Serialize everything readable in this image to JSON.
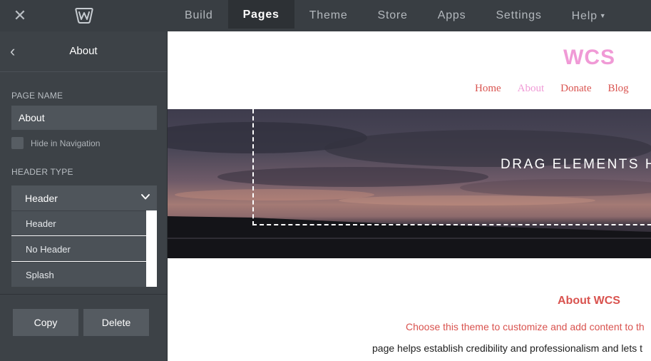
{
  "topbar": {
    "tabs": [
      {
        "label": "Build"
      },
      {
        "label": "Pages"
      },
      {
        "label": "Theme"
      },
      {
        "label": "Store"
      },
      {
        "label": "Apps"
      },
      {
        "label": "Settings"
      },
      {
        "label": "Help"
      }
    ],
    "active_tab": "Pages"
  },
  "sidebar": {
    "title": "About",
    "page_name_label": "PAGE NAME",
    "page_name_value": "About",
    "hide_nav_label": "Hide in Navigation",
    "header_type_label": "HEADER TYPE",
    "header_type_selected": "Header",
    "header_options": [
      "Header",
      "No Header",
      "Splash"
    ],
    "copy_label": "Copy",
    "delete_label": "Delete"
  },
  "preview": {
    "site_title": "WCS",
    "nav_links": [
      "Home",
      "About",
      "Donate",
      "Blog"
    ],
    "active_link": "About",
    "banner_text": "DRAG ELEMENTS HE",
    "about_heading": "About WCS",
    "paragraph_line1": "Choose this theme to customize and add content to th",
    "paragraph_line2": "page helps establish credibility and professionalism and lets t"
  },
  "colors": {
    "accent": "#d9534f",
    "brand_pink": "#f09ad6",
    "topbar_bg": "#393e43",
    "sidebar_bg": "#3d4247"
  }
}
